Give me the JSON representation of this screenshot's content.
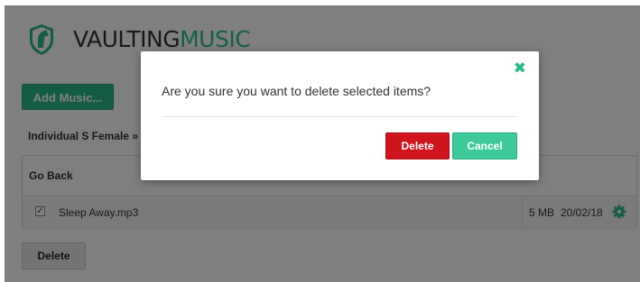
{
  "header": {
    "logo_word_1": "VAULTING",
    "logo_word_2": "MUSIC",
    "logo_icon": "shield-horse-icon"
  },
  "toolbar": {
    "add_music_label": "Add Music..."
  },
  "breadcrumb": {
    "text": "Individual S Female » G"
  },
  "file_panel": {
    "go_back_label": "Go Back",
    "files": [
      {
        "checked": true,
        "name": "Sleep Away.mp3",
        "size": "5 MB",
        "date": "20/02/18",
        "settings_icon": "gear-icon"
      }
    ]
  },
  "footer": {
    "delete_label": "Delete"
  },
  "modal": {
    "message": "Are you sure you want to delete selected items?",
    "close_glyph": "✖",
    "delete_label": "Delete",
    "cancel_label": "Cancel"
  },
  "colors": {
    "accent": "#2bb98b",
    "danger": "#d0141e",
    "overlay": "rgba(0,0,0,0.5)"
  }
}
